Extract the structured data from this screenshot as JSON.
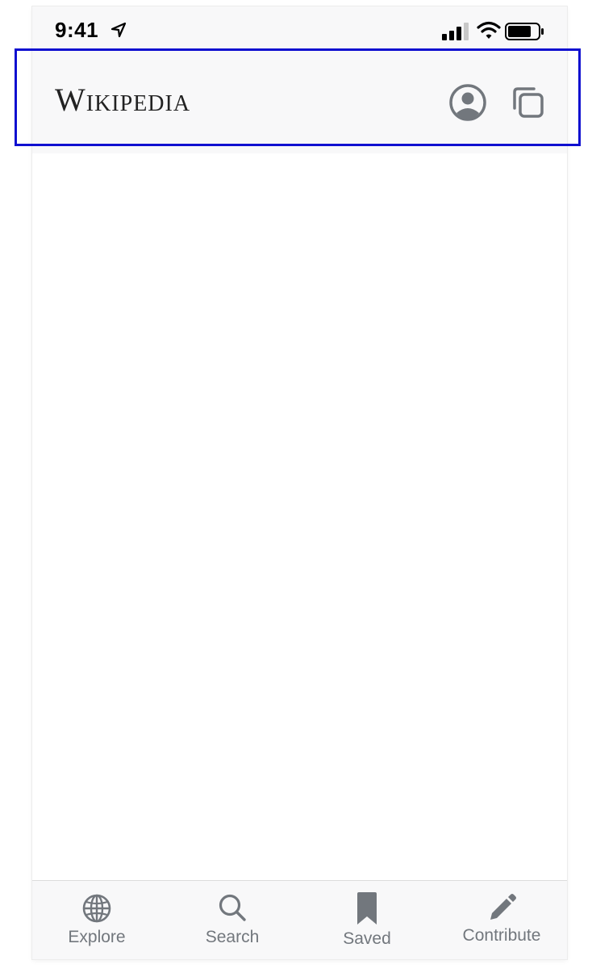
{
  "status_bar": {
    "time": "9:41",
    "location_icon": "location-arrow-icon",
    "signal_icon": "cellular-signal-icon",
    "wifi_icon": "wifi-icon",
    "battery_icon": "battery-icon"
  },
  "header": {
    "wordmark": "Wikipedia",
    "account_icon": "account-circle-icon",
    "tabs_icon": "tabs-icon"
  },
  "tab_bar": {
    "items": [
      {
        "label": "Explore",
        "icon": "globe-icon"
      },
      {
        "label": "Search",
        "icon": "search-icon"
      },
      {
        "label": "Saved",
        "icon": "bookmark-icon"
      },
      {
        "label": "Contribute",
        "icon": "pencil-icon"
      }
    ]
  },
  "colors": {
    "icon_gray": "#72777d",
    "header_bg": "#f8f8f9",
    "highlight": "#1010d0"
  }
}
